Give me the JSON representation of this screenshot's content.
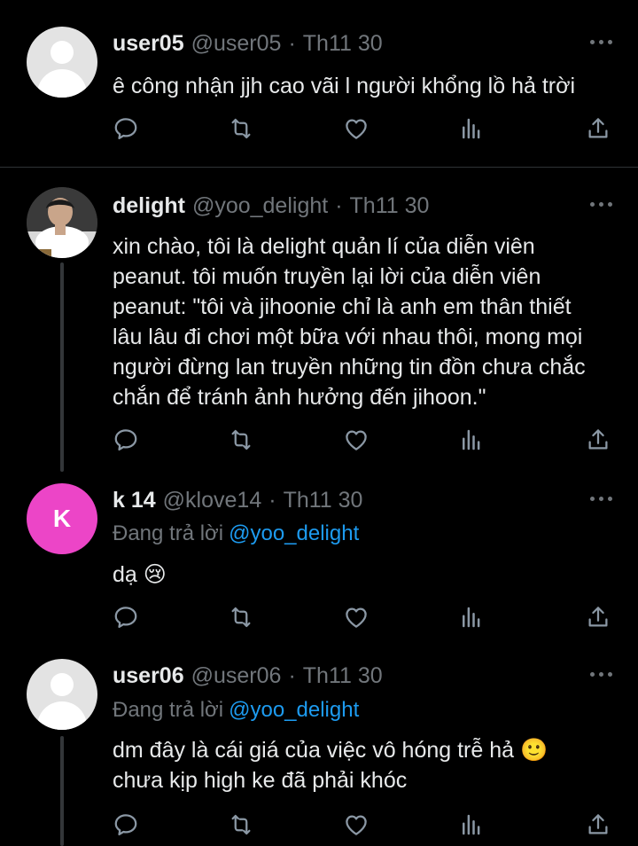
{
  "tweets": [
    {
      "name": "user05",
      "handle": "@user05",
      "time": "Th11 30",
      "reply_to_prefix": "",
      "reply_to_handle": "",
      "lines": [
        "ê công nhận jjh cao vãi l người khổng lồ hả trời"
      ]
    },
    {
      "name": "delight",
      "handle": "@yoo_delight",
      "time": "Th11 30",
      "reply_to_prefix": "",
      "reply_to_handle": "",
      "lines": [
        "xin chào, tôi là delight quản lí của diễn viên",
        "peanut. tôi muốn truyền lại lời của diễn viên",
        "peanut: \"tôi và jihoonie chỉ là anh em thân thiết",
        "lâu lâu đi chơi một bữa với nhau thôi, mong mọi",
        "người đừng lan truyền những tin đồn chưa chắc",
        "chắn để tránh ảnh hưởng đến jihoon.\""
      ]
    },
    {
      "name": "k 14",
      "handle": "@klove14",
      "time": "Th11 30",
      "avatar_letter": "K",
      "reply_to_prefix": "Đang trả lời",
      "reply_to_handle": "@yoo_delight",
      "lines": [
        "dạ 😢"
      ]
    },
    {
      "name": "user06",
      "handle": "@user06",
      "time": "Th11 30",
      "reply_to_prefix": "Đang trả lời",
      "reply_to_handle": "@yoo_delight",
      "lines": [
        "dm đây là cái giá của việc vô hóng trễ hả 🙂",
        "chưa kịp high ke đã phải khóc"
      ]
    }
  ],
  "separator": "·",
  "icons": {
    "reply": "reply-icon",
    "retweet": "retweet-icon",
    "like": "heart-icon",
    "views": "views-chart-icon",
    "share": "share-icon",
    "more": "more-dots-icon"
  },
  "colors": {
    "background": "#000000",
    "text": "#e7e9ea",
    "muted": "#71767b",
    "link": "#1d9bf0",
    "avatar_k": "#ec45c7"
  }
}
